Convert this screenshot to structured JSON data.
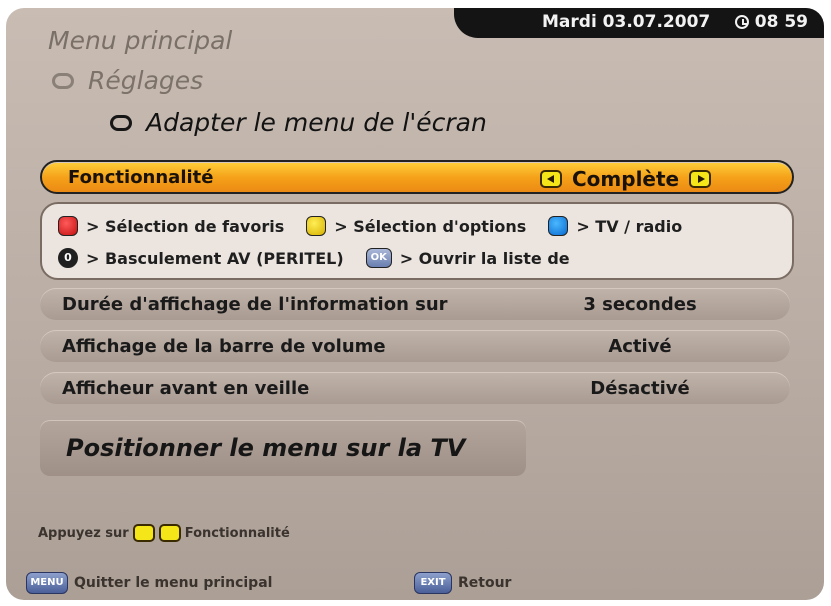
{
  "header": {
    "date": "Mardi 03.07.2007",
    "time": "08 59"
  },
  "breadcrumb": {
    "level1": "Menu principal",
    "level2": "Réglages",
    "level3": "Adapter le menu de l'écran"
  },
  "selected_row": {
    "label": "Fonctionnalité",
    "value": "Complète"
  },
  "info": {
    "red": "> Sélection de favoris",
    "yellow": "> Sélection d'options",
    "blue": "> TV / radio",
    "zero_key": "0",
    "zero": "> Basculement AV (PERITEL)",
    "ok_key": "OK",
    "ok": "> Ouvrir la liste de"
  },
  "rows": [
    {
      "label": "Durée d'affichage de l'information sur",
      "value": "3 secondes"
    },
    {
      "label": "Affichage de la barre de volume",
      "value": "Activé"
    },
    {
      "label": "Afficheur avant en veille",
      "value": "Désactivé"
    }
  ],
  "position_button": "Positionner le menu sur la TV",
  "hint": {
    "prefix": "Appuyez sur",
    "suffix": "Fonctionnalité"
  },
  "footer": {
    "menu_key": "MENU",
    "menu_label": "Quitter le menu principal",
    "exit_key": "EXIT",
    "exit_label": "Retour"
  },
  "colors": {
    "selected_row": "#f5a21a",
    "background": "#b9ada4",
    "topbar": "#141414"
  }
}
